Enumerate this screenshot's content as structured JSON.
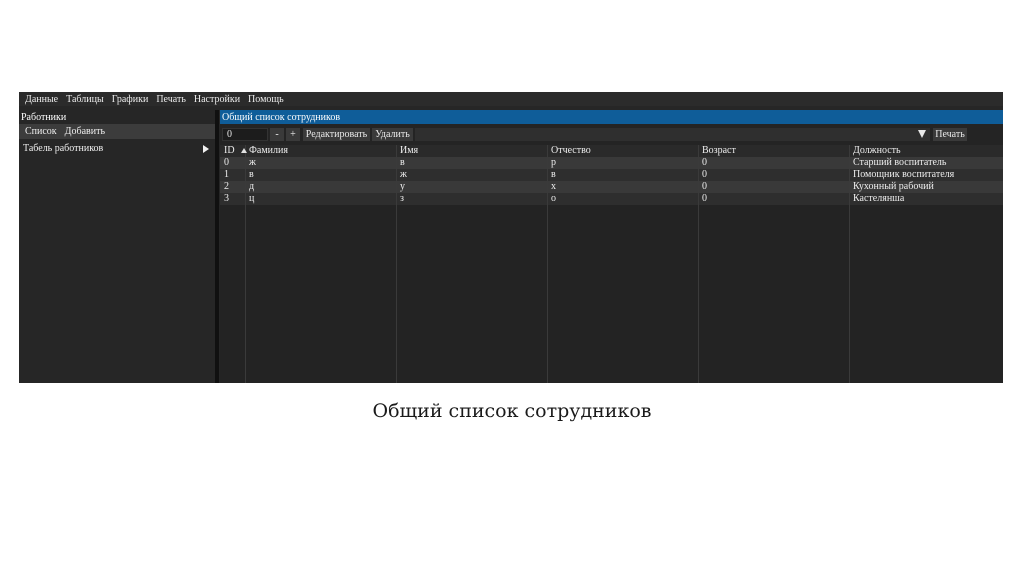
{
  "menu": [
    "Данные",
    "Таблицы",
    "Графики",
    "Печать",
    "Настройки",
    "Помощь"
  ],
  "sidebar": {
    "title": "Работники",
    "tabs": [
      "Список",
      "Добавить"
    ],
    "items": [
      {
        "label": "Табель работников"
      }
    ]
  },
  "panel_title": "Общий список сотрудников",
  "toolbar": {
    "value": "0",
    "minus_label": "-",
    "plus_label": "+",
    "edit_label": "Редактировать",
    "delete_label": "Удалить",
    "print_label": "Печать"
  },
  "table": {
    "columns": [
      "ID",
      "Фамилия",
      "Имя",
      "Отчество",
      "Возраст",
      "Должность"
    ],
    "rows": [
      [
        "0",
        "ж",
        "в",
        "р",
        "0",
        "Старший воспитатель"
      ],
      [
        "1",
        "в",
        "ж",
        "в",
        "0",
        "Помощник воспитателя"
      ],
      [
        "2",
        "д",
        "у",
        "х",
        "0",
        "Кухонный рабочий"
      ],
      [
        "3",
        "ц",
        "з",
        "о",
        "0",
        "Кастелянша"
      ]
    ]
  },
  "caption": "Общий список сотрудников",
  "colors": {
    "accent": "#0f5d99",
    "background": "#262626"
  }
}
